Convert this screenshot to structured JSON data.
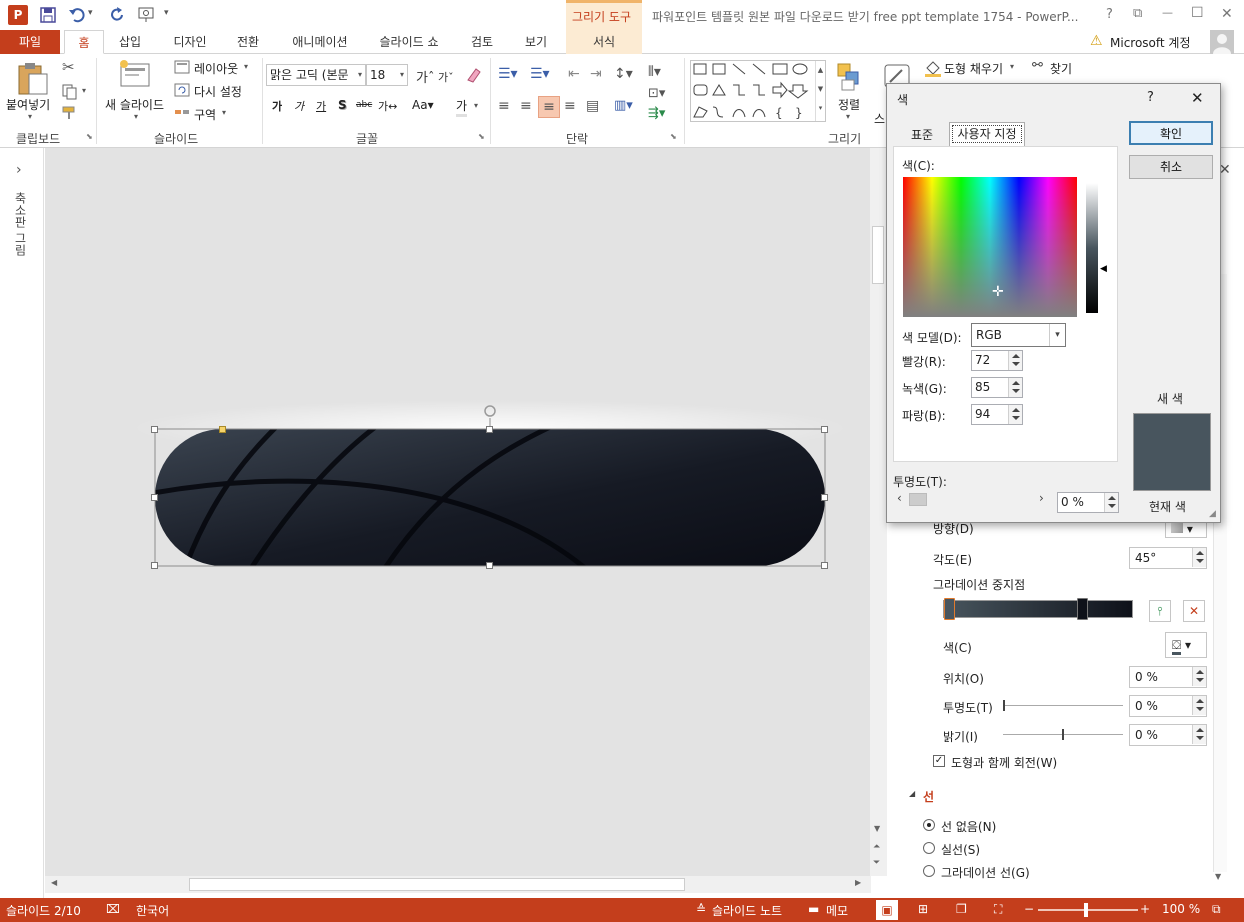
{
  "titlebar": {
    "app_icon": "P",
    "contextual_group": "그리기 도구",
    "title": "파워포인트 템플릿 원본 파일 다운로드 받기 free ppt template 1754 - PowerP...",
    "help": "?",
    "restore_ribbon": "⧉",
    "minimize": "—",
    "maximize": "☐",
    "close": "✕"
  },
  "tabs": {
    "file": "파일",
    "home": "홈",
    "insert": "삽입",
    "design": "디자인",
    "transitions": "전환",
    "animations": "애니메이션",
    "slideshow": "슬라이드 쇼",
    "review": "검토",
    "view": "보기",
    "format": "서식",
    "account": "Microsoft 계정"
  },
  "ribbon": {
    "paste": "붙여넣기",
    "new_slide": "새 슬라이드",
    "layout": "레이아웃",
    "reset": "다시 설정",
    "section": "구역",
    "font_name": "맑은 고딕 (본문",
    "font_size": "18",
    "arrange": "정렬",
    "shape_fill": "도형 채우기",
    "find": "찾기",
    "groups": {
      "clipboard": "클립보드",
      "slides": "슬라이드",
      "font": "글꼴",
      "paragraph": "단락",
      "drawing": "그리기"
    }
  },
  "left_pane": {
    "label": "축소판 그림"
  },
  "status": {
    "slide": "슬라이드 2/10",
    "language": "한국어",
    "notes": "슬라이드 노트",
    "comments": "메모",
    "zoom": "100 %"
  },
  "dialog": {
    "title": "색",
    "help": "?",
    "close": "✕",
    "tab_standard": "표준",
    "tab_custom": "사용자 지정",
    "colors_label": "색(C):",
    "model_label": "색 모델(D):",
    "model_value": "RGB",
    "red_label": "빨강(R):",
    "red_value": "72",
    "green_label": "녹색(G):",
    "green_value": "85",
    "blue_label": "파랑(B):",
    "blue_value": "94",
    "transparency_label": "투명도(T):",
    "transparency_value": "0 %",
    "ok": "확인",
    "cancel": "취소",
    "new_label": "새 색",
    "current_label": "현재 색",
    "new_color": "#48555e"
  },
  "format_pane": {
    "direction": "방향(D)",
    "angle_label": "각도(E)",
    "angle_value": "45°",
    "stops_label": "그라데이션 중지점",
    "color_label": "색(C)",
    "position_label": "위치(O)",
    "position_value": "0 %",
    "transparency_label": "투명도(T)",
    "transparency_value": "0 %",
    "brightness_label": "밝기(I)",
    "brightness_value": "0 %",
    "rotate_with_shape": "도형과 함께 회전(W)",
    "line_section": "선",
    "no_line": "선 없음(N)",
    "solid_line": "실선(S)",
    "gradient_line": "그라데이션 선(G)"
  },
  "colors": {
    "accent": "#c43e1c",
    "shape_dark": "#0e1119",
    "shape_light": "#3b4450"
  }
}
